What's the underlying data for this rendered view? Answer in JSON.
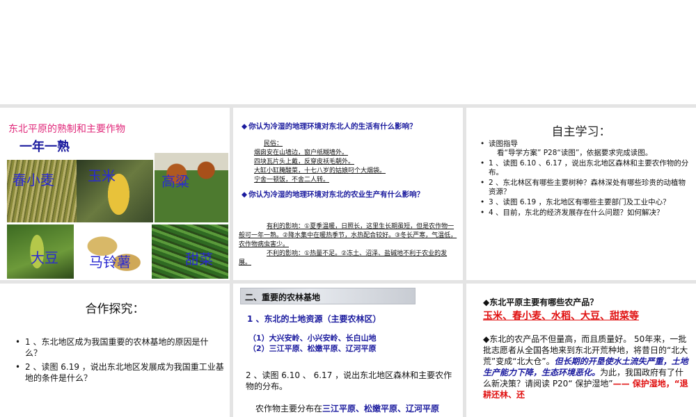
{
  "slide1": {
    "title": "东北平原的熟制和主要作物",
    "subtitle": "一年一熟",
    "crops": [
      "春小麦",
      "玉米",
      "高粱",
      "大豆",
      "马铃薯",
      "甜菜"
    ]
  },
  "slide2": {
    "q1": "你认为冷湿的地理环境对东北人的生活有什么影响？",
    "customs_label": "民俗：",
    "customs": [
      "烟囱安在山墙边，窗户纸糊墙外。",
      "四块瓦片头上戴，反穿皮袄毛朝外。",
      "大缸小缸腌酸菜，十七八岁的姑娘叼个大烟袋。",
      "宁舍一顿饭，不舍二人转。"
    ],
    "q2": "你认为冷湿的地理环境对东北的农业生产有什么影响？",
    "favorable": "有利的影响：①夏季温暖，日照长，这里生长期虽短，但是农作物一般可一年一熟。②降水集中在暖热季节，水热配合较好。③冬长严寒，气温低，农作物病虫害少。",
    "unfavorable": "不利的影响：①热量不足。②冻土、沼泽、盐碱地不利于农业的发展。"
  },
  "slide3": {
    "title": "自主学习：",
    "items": [
      {
        "head": "读图指导",
        "body": "看“导学方案” P28“读图”，依据要求完成读图。"
      },
      {
        "head": "",
        "body": "1 、读图 6.10 、6.17 ，说出东北地区森林和主要农作物的分布。"
      },
      {
        "head": "",
        "body": "2 、东北林区有哪些主要树种？森林深处有哪些珍贵的动植物资源？"
      },
      {
        "head": "",
        "body": "3 、读图 6.19 ，东北地区有哪些主要部门及工业中心？"
      },
      {
        "head": "",
        "body": "4 、目前，东北的经济发展存在什么问题？如何解决？"
      }
    ]
  },
  "slide4": {
    "title": "合作探究：",
    "items": [
      "1 、东北地区成为我国重要的农林基地的原因是什么？",
      "2 、读图 6.19 ，说出东北地区发展成为我国重工业基地的条件是什么？"
    ]
  },
  "slide5": {
    "header": "二、重要的农林基地",
    "h1": "1 、东北的土地资源（主要农林区）",
    "sub1": "（1）大兴安岭、小兴安岭、长白山地",
    "sub2": "（2）三江平原、松嫩平原、辽河平原",
    "body": "2 、读图 6.10 、 6.17 ，说出东北地区森林和主要农作物的分布。",
    "body2_prefix": "农作物主要分布在",
    "body2_places": "三江平原、松嫩平原、辽河平原"
  },
  "slide6": {
    "question": "◆东北平原主要有哪些农产品？",
    "answer": "玉米、春小麦、水稻、大豆、甜菜等",
    "p1": "◆东北的农产品不但量高，而且质量好。 50年来，一批批志愿者从全国各地来到东北开荒种地，将昔日的“北大荒”变成“北大仓”。",
    "p1_em": "但长期的开垦使水土流失严重，土地生产能力下降，生态环境恶化。",
    "p1_tail": "为此，我国政府有了什么新决策？请阅读 P20“ 保护湿地”",
    "p1_red": "—— 保护湿地，“退耕还林、还"
  }
}
